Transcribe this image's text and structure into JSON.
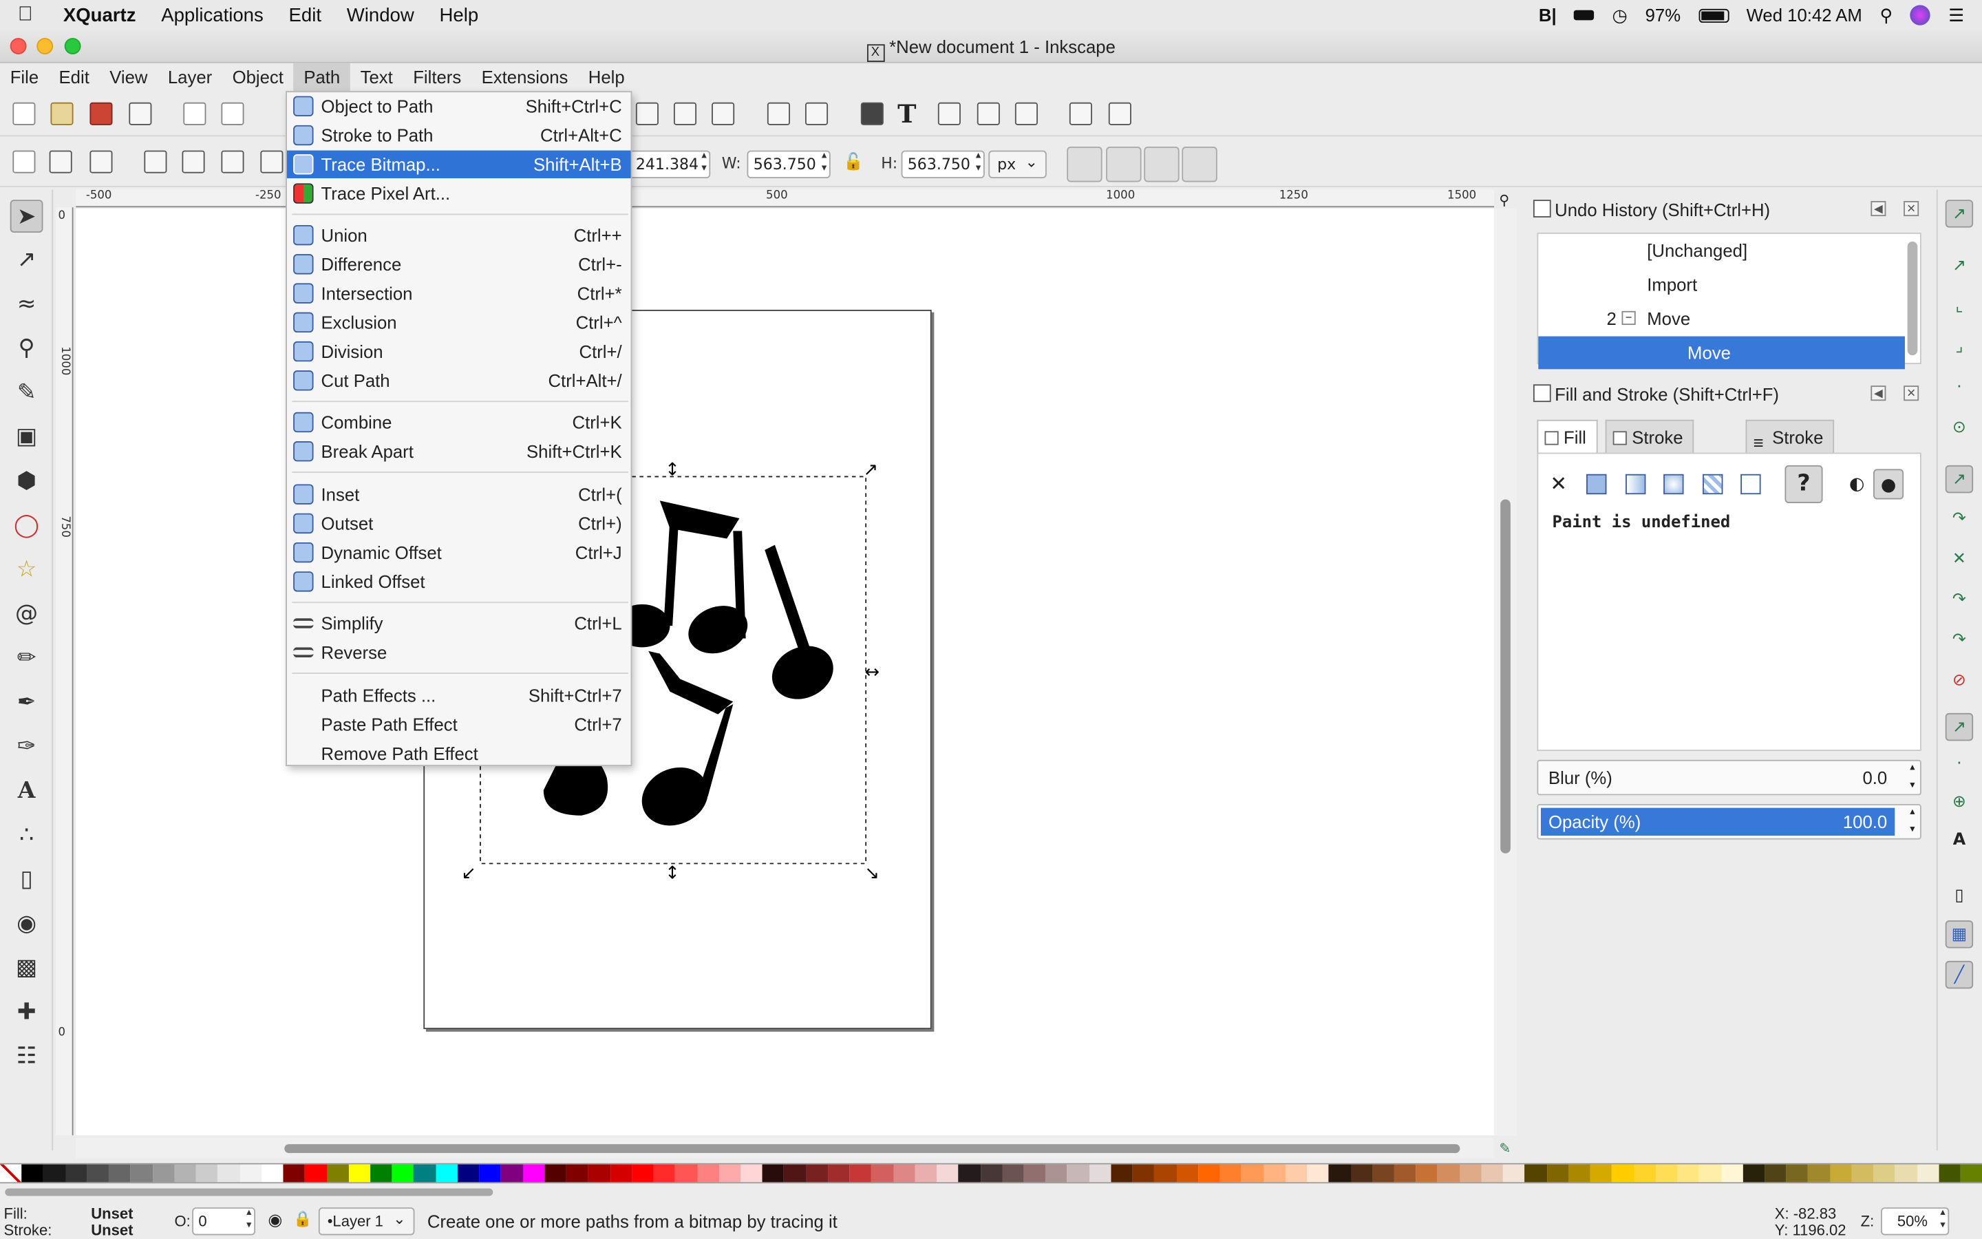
{
  "mac_menubar": {
    "app_name": "XQuartz",
    "items": [
      "Applications",
      "Edit",
      "Window",
      "Help"
    ],
    "battery": "97%",
    "clock": "Wed 10:42 AM"
  },
  "window": {
    "title": "*New document 1 - Inkscape"
  },
  "app_menu": [
    "File",
    "Edit",
    "View",
    "Layer",
    "Object",
    "Path",
    "Text",
    "Filters",
    "Extensions",
    "Help"
  ],
  "toolbar2": {
    "y_value": "241.384",
    "w_label": "W:",
    "w_value": "563.750",
    "h_label": "H:",
    "h_value": "563.750",
    "unit": "px"
  },
  "rulers": {
    "h_ticks": [
      "-500",
      "-250",
      "500",
      "1000",
      "1250",
      "1500"
    ],
    "v_ticks": [
      "0",
      "1000",
      "750",
      "0"
    ]
  },
  "path_menu": {
    "items": [
      {
        "label": "Object to Path",
        "shortcut": "Shift+Ctrl+C"
      },
      {
        "label": "Stroke to Path",
        "shortcut": "Ctrl+Alt+C"
      },
      {
        "label": "Trace Bitmap...",
        "shortcut": "Shift+Alt+B"
      },
      {
        "label": "Trace Pixel Art...",
        "shortcut": ""
      },
      {
        "label": "Union",
        "shortcut": "Ctrl++"
      },
      {
        "label": "Difference",
        "shortcut": "Ctrl+-"
      },
      {
        "label": "Intersection",
        "shortcut": "Ctrl+*"
      },
      {
        "label": "Exclusion",
        "shortcut": "Ctrl+^"
      },
      {
        "label": "Division",
        "shortcut": "Ctrl+/"
      },
      {
        "label": "Cut Path",
        "shortcut": "Ctrl+Alt+/"
      },
      {
        "label": "Combine",
        "shortcut": "Ctrl+K"
      },
      {
        "label": "Break Apart",
        "shortcut": "Shift+Ctrl+K"
      },
      {
        "label": "Inset",
        "shortcut": "Ctrl+("
      },
      {
        "label": "Outset",
        "shortcut": "Ctrl+)"
      },
      {
        "label": "Dynamic Offset",
        "shortcut": "Ctrl+J"
      },
      {
        "label": "Linked Offset",
        "shortcut": ""
      },
      {
        "label": "Simplify",
        "shortcut": "Ctrl+L"
      },
      {
        "label": "Reverse",
        "shortcut": ""
      },
      {
        "label": "Path Effects ...",
        "shortcut": "Shift+Ctrl+7"
      },
      {
        "label": "Paste Path Effect",
        "shortcut": "Ctrl+7"
      },
      {
        "label": "Remove Path Effect",
        "shortcut": ""
      }
    ],
    "highlighted": "Trace Bitmap..."
  },
  "undo_history": {
    "title": "Undo History (Shift+Ctrl+H)",
    "rows": [
      {
        "label": "[Unchanged]",
        "count": ""
      },
      {
        "label": "Import",
        "count": ""
      },
      {
        "label": "Move",
        "count": "2"
      },
      {
        "label": "Move",
        "count": ""
      }
    ],
    "selected_index": 3
  },
  "fill_stroke": {
    "title": "Fill and Stroke (Shift+Ctrl+F)",
    "tabs": [
      "Fill",
      "Stroke paint",
      "Stroke style"
    ],
    "active_tab": "Fill",
    "message": "Paint is undefined",
    "blur_label": "Blur (%)",
    "blur_value": "0.0",
    "opacity_label": "Opacity (%)",
    "opacity_value": "100.0",
    "opacity_fraction": 1.0
  },
  "statusbar": {
    "fill_label": "Fill:",
    "fill_value": "Unset",
    "stroke_label": "Stroke:",
    "stroke_value": "Unset",
    "opacity_label": "O:",
    "opacity_value": "0",
    "layer": "•Layer 1",
    "message": "Create one or more paths from a bitmap by tracing it",
    "x_readout": "X: -82.83",
    "y_readout": "Y: 1196.02",
    "zoom_label": "Z:",
    "zoom_value": "50%"
  },
  "palette_colors": [
    "#000000",
    "#1a1a1a",
    "#333333",
    "#4d4d4d",
    "#666666",
    "#808080",
    "#999999",
    "#b3b3b3",
    "#cccccc",
    "#e6e6e6",
    "#f2f2f2",
    "#ffffff",
    "#800000",
    "#ff0000",
    "#808000",
    "#ffff00",
    "#008000",
    "#00ff00",
    "#008080",
    "#00ffff",
    "#000080",
    "#0000ff",
    "#800080",
    "#ff00ff",
    "#550000",
    "#800000",
    "#aa0000",
    "#d40000",
    "#ff0000",
    "#ff2a2a",
    "#ff5555",
    "#ff8080",
    "#ffaaaa",
    "#ffd5d5",
    "#280b0b",
    "#501616",
    "#782121",
    "#a02c2c",
    "#c83737",
    "#d35f5f",
    "#de8787",
    "#e9afaf",
    "#f4d7d7",
    "#241c1c",
    "#483737",
    "#6c5353",
    "#916f6f",
    "#ac9393",
    "#c8b7b7",
    "#e3dbdb",
    "#552200",
    "#803300",
    "#aa4400",
    "#d45500",
    "#ff6600",
    "#ff7f2a",
    "#ff9955",
    "#ffb380",
    "#ffccaa",
    "#ffe6d5",
    "#28170b",
    "#502d16",
    "#784421",
    "#a05a2c",
    "#c87137",
    "#d38d5f",
    "#deaa87",
    "#e9c6af",
    "#f4e3d7",
    "#554400",
    "#806600",
    "#aa8800",
    "#d4aa00",
    "#ffcc00",
    "#ffd42a",
    "#ffdd55",
    "#ffe680",
    "#ffeeaa",
    "#fff6d5",
    "#28220b",
    "#504416",
    "#786721",
    "#a0892c",
    "#c8ab37",
    "#d3bc5f",
    "#decd87",
    "#e9ddaf",
    "#f4eed7",
    "#445500",
    "#668000"
  ]
}
